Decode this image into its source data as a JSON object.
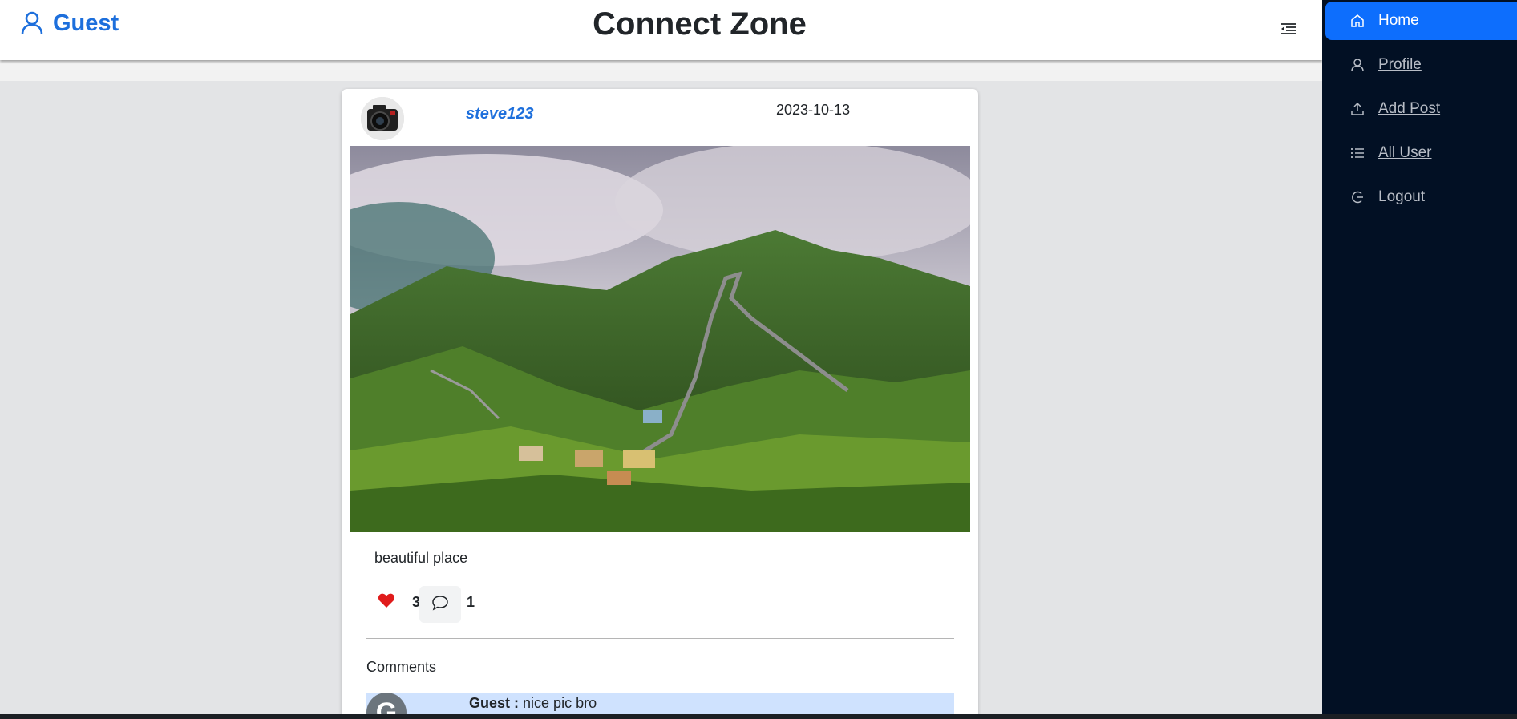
{
  "header": {
    "user_label": "Guest",
    "app_title": "Connect Zone",
    "user_icon": "user-icon",
    "toggle_icon": "sidebar-toggle-icon"
  },
  "sidebar": {
    "items": [
      {
        "label": "Home",
        "icon": "home-icon",
        "active": true
      },
      {
        "label": "Profile",
        "icon": "user-icon",
        "active": false
      },
      {
        "label": "Add Post",
        "icon": "upload-icon",
        "active": false
      },
      {
        "label": "All User",
        "icon": "list-icon",
        "active": false
      },
      {
        "label": "Logout",
        "icon": "logout-icon",
        "active": false
      }
    ]
  },
  "post": {
    "username": "steve123",
    "date": "2023-10-13",
    "caption": "beautiful place",
    "likes": "3",
    "comments_count": "1",
    "comments_heading": "Comments",
    "comments": [
      {
        "avatar_letter": "G",
        "author": "Guest :",
        "text": "nice pic bro"
      }
    ]
  },
  "colors": {
    "accent": "#0d6efd",
    "brand_blue": "#1d6fdc",
    "sidebar_bg": "#021024",
    "like_red": "#e01b1b",
    "comment_highlight": "#cfe2fe"
  }
}
